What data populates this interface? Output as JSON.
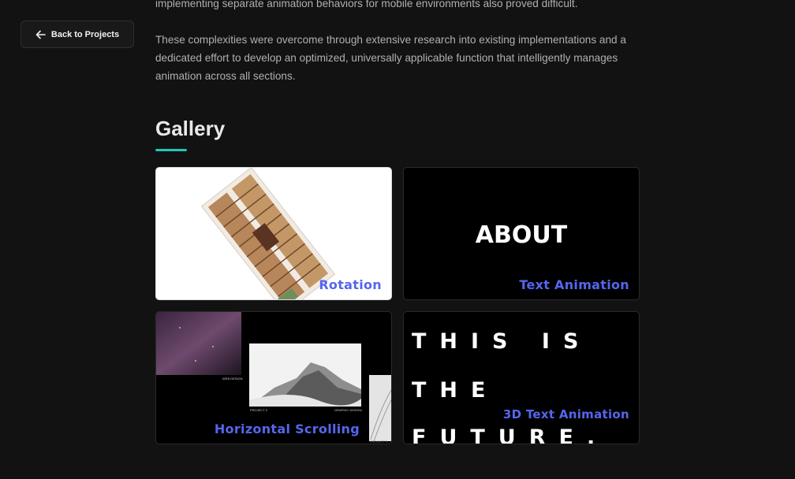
{
  "nav": {
    "back_label": "Back to Projects"
  },
  "body_text": {
    "top_line": "implementing separate animation behaviors for mobile environments also proved difficult.",
    "paragraph": "These complexities were overcome through extensive research into existing implementations and a dedicated effort to develop an optimized, universally applicable function that intelligently manages animation across all sections."
  },
  "gallery": {
    "title": "Gallery",
    "accent_color": "#1fc8b8",
    "label_color": "#5566ee",
    "items": [
      {
        "label": "Rotation",
        "preview": "rotated building photo"
      },
      {
        "label": "Text Animation",
        "preview_text": "ABOUT"
      },
      {
        "label": "Horizontal Scrolling",
        "preview_captions": [
          "WEB DESIGN",
          "PROJECT 2",
          "GRAPHIC DESIGN",
          "PROJECT 3"
        ]
      },
      {
        "label": "3D Text Animation",
        "preview_lines": [
          "THIS IS",
          "THE",
          "FUTURE."
        ]
      }
    ]
  }
}
